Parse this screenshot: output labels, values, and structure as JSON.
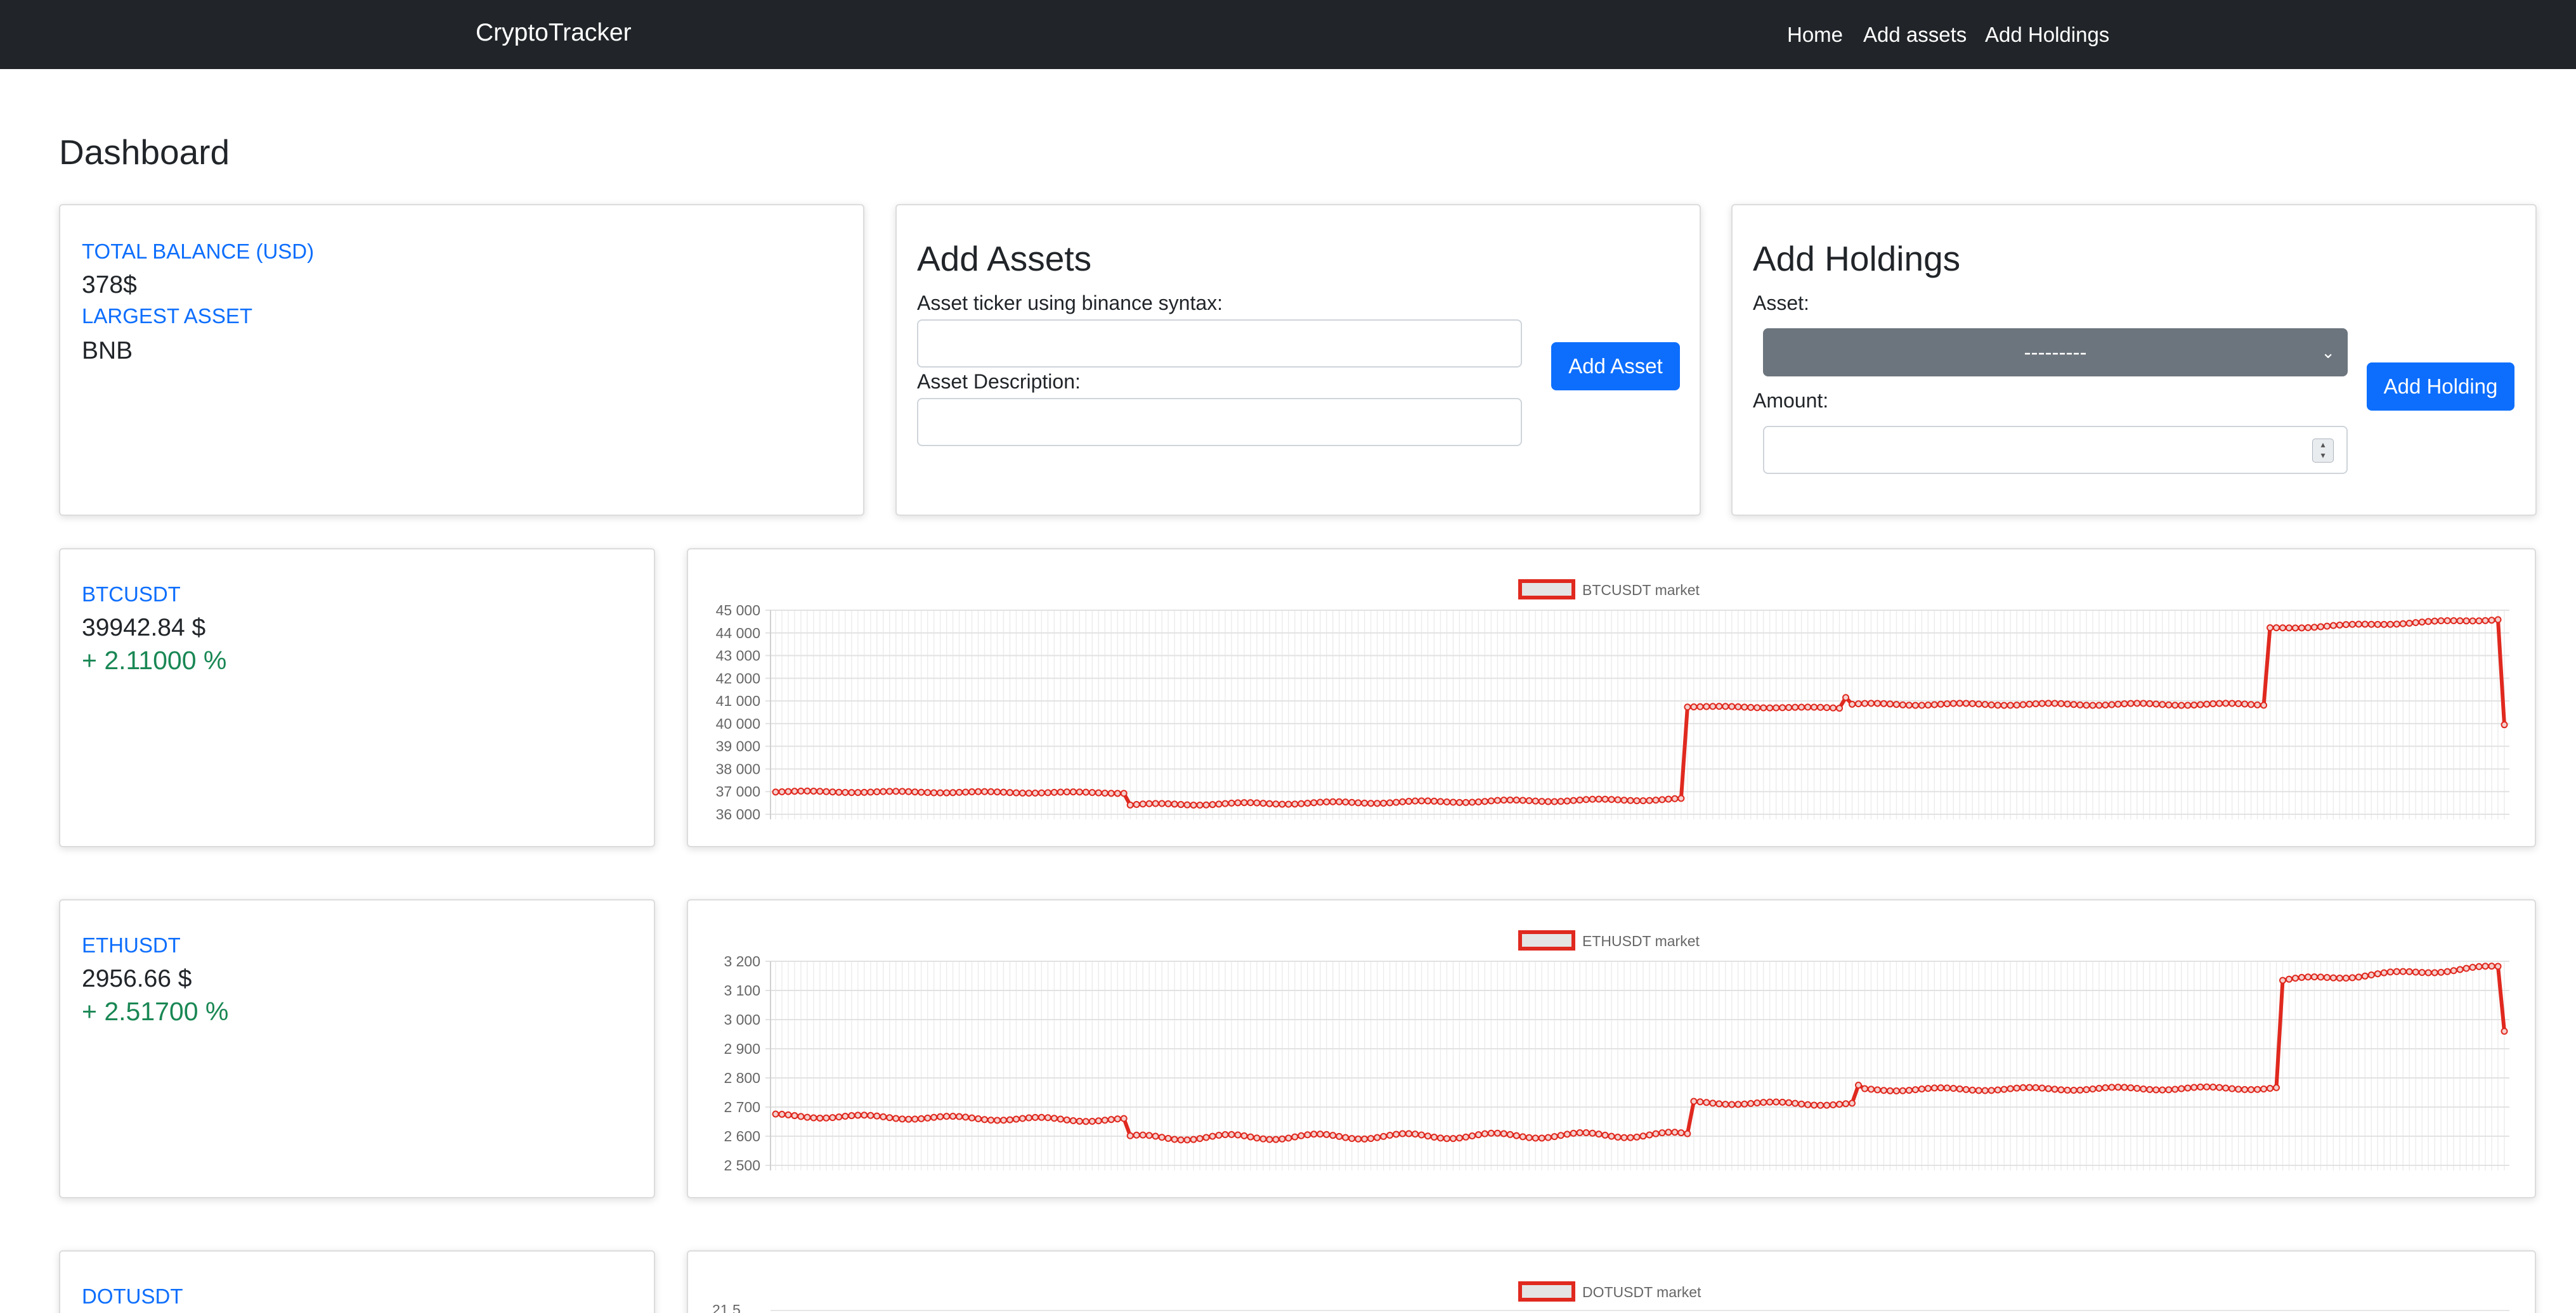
{
  "nav": {
    "brand": "CryptoTracker",
    "links": [
      "Home",
      "Add assets",
      "Add Holdings"
    ]
  },
  "page_title": "Dashboard",
  "summary": {
    "total_balance_label": "TOTAL BALANCE (USD)",
    "total_balance_value": "378$",
    "largest_asset_label": "LARGEST ASSET",
    "largest_asset_value": "BNB"
  },
  "add_assets": {
    "title": "Add Assets",
    "ticker_label": "Asset ticker using binance syntax:",
    "ticker_value": "",
    "description_label": "Asset Description:",
    "description_value": "",
    "button_label": "Add Asset"
  },
  "add_holdings": {
    "title": "Add Holdings",
    "asset_label": "Asset:",
    "asset_selected": "---------",
    "amount_label": "Amount:",
    "amount_value": "",
    "button_label": "Add Holding"
  },
  "assets": [
    {
      "ticker": "BTCUSDT",
      "price": "39942.84 $",
      "change": "+ 2.11000 %"
    },
    {
      "ticker": "ETHUSDT",
      "price": "2956.66 $",
      "change": "+ 2.51700 %"
    },
    {
      "ticker": "DOTUSDT",
      "price": "",
      "change": ""
    }
  ],
  "colors": {
    "navbar": "#212529",
    "accent": "#0d6efd",
    "positive": "#198754",
    "series_line": "#e0291f",
    "legend_fill": "#e4e4e4"
  },
  "chart_data": [
    {
      "type": "line",
      "title": "",
      "legend": [
        "BTCUSDT market"
      ],
      "legend_position": "top",
      "ylim": [
        36000,
        45000
      ],
      "yticks": [
        "45 000",
        "44 000",
        "43 000",
        "42 000",
        "41 000",
        "40 000",
        "39 000",
        "38 000",
        "37 000",
        "36 000"
      ],
      "grid": true,
      "series": [
        {
          "name": "BTCUSDT market",
          "segments": [
            {
              "n": 56,
              "start": 37000,
              "end": 36950,
              "wiggle": 30
            },
            {
              "n": 88,
              "start": 36420,
              "end": 36660,
              "wiggle": 45
            },
            {
              "n": 25,
              "start": 40750,
              "end": 40690,
              "wiggle": 25
            },
            {
              "n": 1,
              "start": 41150,
              "end": 41150,
              "wiggle": 0
            },
            {
              "n": 66,
              "start": 40850,
              "end": 40850,
              "wiggle": 45
            },
            {
              "n": 37,
              "start": 44200,
              "end": 44600,
              "wiggle": 35
            },
            {
              "n": 1,
              "start": 39950,
              "end": 39950,
              "wiggle": 0
            }
          ]
        }
      ]
    },
    {
      "type": "line",
      "title": "",
      "legend": [
        "ETHUSDT market"
      ],
      "legend_position": "top",
      "ylim": [
        2500,
        3200
      ],
      "yticks": [
        "3 200",
        "3 100",
        "3 000",
        "2 900",
        "2 800",
        "2 700",
        "2 600",
        "2 500"
      ],
      "grid": true,
      "series": [
        {
          "name": "ETHUSDT market",
          "segments": [
            {
              "n": 56,
              "start": 2670,
              "end": 2655,
              "wiggle": 6
            },
            {
              "n": 89,
              "start": 2595,
              "end": 2605,
              "wiggle": 9
            },
            {
              "n": 26,
              "start": 2715,
              "end": 2710,
              "wiggle": 5
            },
            {
              "n": 1,
              "start": 2775,
              "end": 2775,
              "wiggle": 0
            },
            {
              "n": 66,
              "start": 2760,
              "end": 2765,
              "wiggle": 5
            },
            {
              "n": 35,
              "start": 3135,
              "end": 3180,
              "wiggle": 6
            },
            {
              "n": 1,
              "start": 2960,
              "end": 2960,
              "wiggle": 0
            }
          ]
        }
      ]
    },
    {
      "type": "line",
      "title": "",
      "legend": [
        "DOTUSDT market"
      ],
      "legend_position": "top",
      "yticks": [
        "21.5"
      ],
      "grid": true,
      "series": [
        {
          "name": "DOTUSDT market",
          "segments": []
        }
      ]
    }
  ]
}
